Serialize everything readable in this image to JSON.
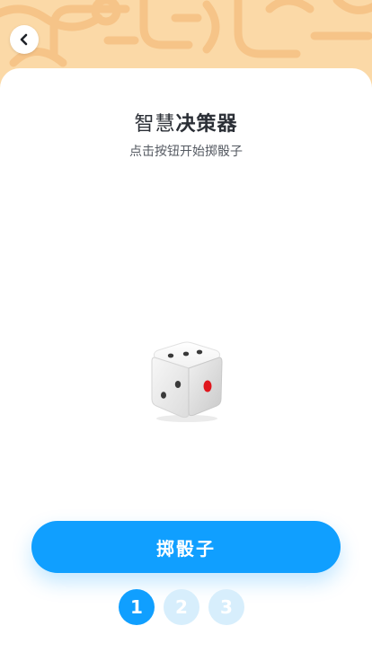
{
  "header": {
    "back_icon": "chevron-left-icon",
    "background_color": "#fbd9a7",
    "pattern_color": "#f6c488"
  },
  "main": {
    "title_normal": "智慧",
    "title_bold": "决策器",
    "subtitle": "点击按钮开始掷骰子",
    "dice_icon": "dice-icon"
  },
  "action": {
    "roll_label": "掷骰子",
    "accent_color": "#109fff"
  },
  "steps": [
    {
      "label": "1",
      "active": true
    },
    {
      "label": "2",
      "active": false
    },
    {
      "label": "3",
      "active": false
    }
  ]
}
